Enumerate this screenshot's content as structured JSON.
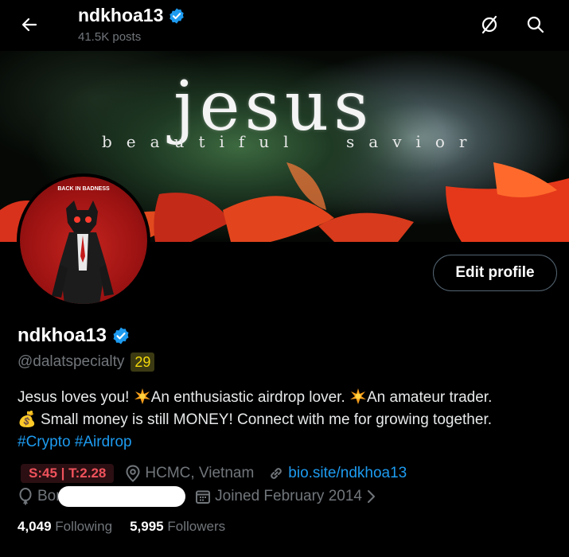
{
  "header": {
    "title": "ndkhoa13",
    "posts_count": "41.5K posts"
  },
  "banner": {
    "big_text": "jesus",
    "small_left": "beautiful",
    "small_right": "savior"
  },
  "avatar": {
    "caption": "BACK IN BADNESS"
  },
  "profile": {
    "name": "ndkhoa13",
    "handle": "@dalatspecialty",
    "badge": "29",
    "edit_button": "Edit profile"
  },
  "bio": {
    "line1_a": "Jesus loves you! ",
    "line1_b": "An enthusiastic airdrop lover. ",
    "line1_c": "An amateur trader.",
    "line2_emoji": "💰",
    "line2": " Small money is still MONEY! Connect with me for growing together.",
    "hashtag1": "#Crypto",
    "hashtag2": "#Airdrop"
  },
  "meta": {
    "st_badge": "S:45 | T:2.28",
    "location": "HCMC, Vietnam",
    "link": "bio.site/ndkhoa13",
    "born_prefix": "Born",
    "joined": "Joined February 2014"
  },
  "stats": {
    "following_count": "4,049",
    "following_label": "Following",
    "followers_count": "5,995",
    "followers_label": "Followers"
  },
  "colors": {
    "accent": "#1d9bf0",
    "verified": "#1d9bf0",
    "secondary_text": "#71767b",
    "badge_red": "#f0525c",
    "badge_yellow": "#f5d90a"
  }
}
